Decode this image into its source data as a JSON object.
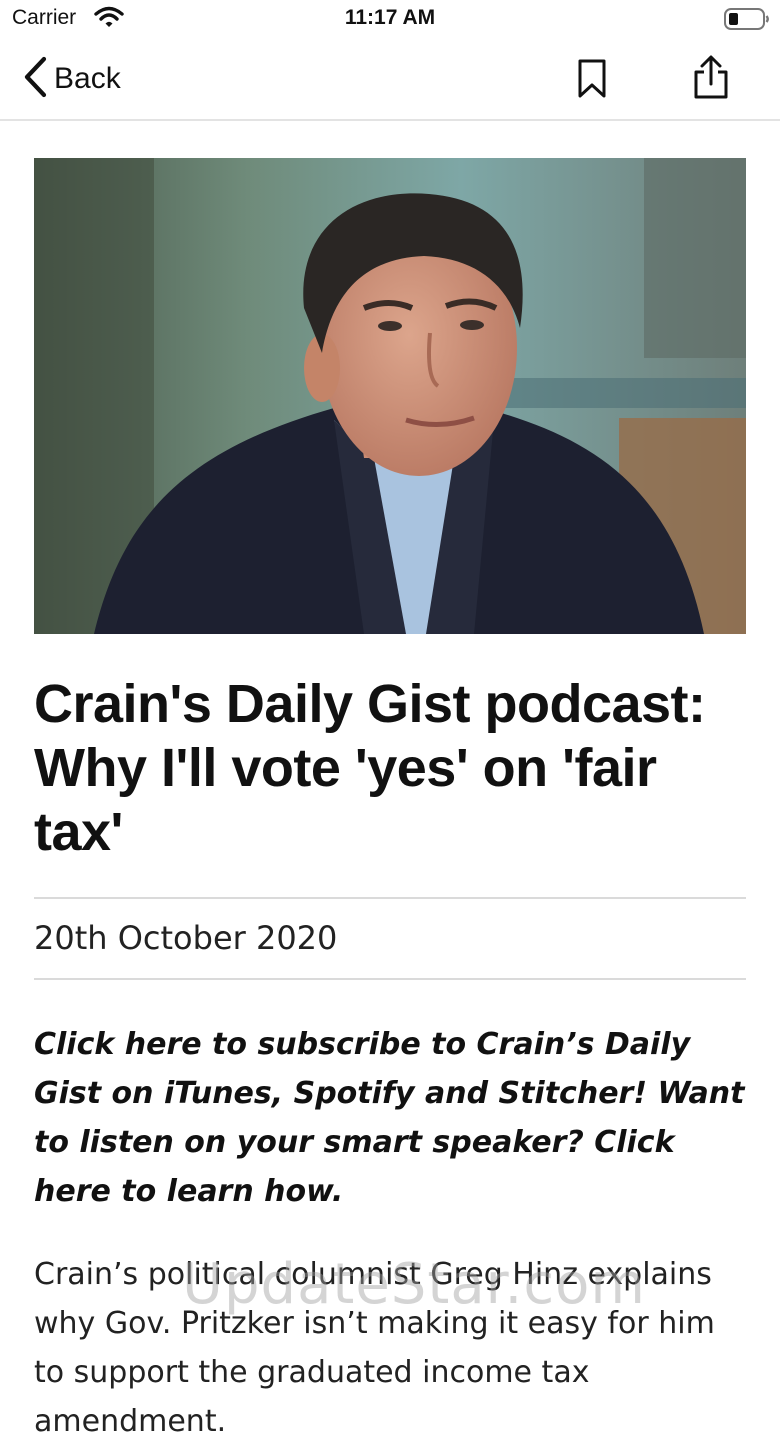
{
  "status_bar": {
    "carrier": "Carrier",
    "time": "11:17 AM",
    "wifi_icon": "wifi-icon",
    "battery_icon": "battery-low-icon"
  },
  "nav": {
    "back_label": "Back",
    "back_icon": "chevron-left-icon",
    "bookmark_icon": "bookmark-icon",
    "share_icon": "share-icon"
  },
  "article": {
    "title": "Crain's Daily Gist podcast: Why I'll vote 'yes' on 'fair tax'",
    "date": "20th October 2020",
    "promo": {
      "link1": "Click here to subscribe to Crain’s Daily Gist on iTunes, Spotify and Stitcher!",
      "middle": " Want to listen on your smart speaker? ",
      "link2": "Click here to learn how."
    },
    "body": "Crain’s political columnist Greg Hinz explains why Gov. Pritzker isn’t making it easy for him to support the graduated income tax amendment."
  },
  "watermark": "UpdateStar.com"
}
